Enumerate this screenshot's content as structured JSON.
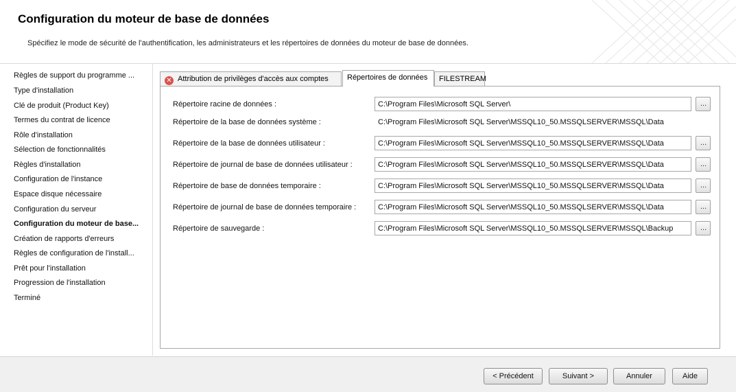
{
  "header": {
    "title": "Configuration du moteur de base de données",
    "subtitle": "Spécifiez le mode de sécurité de l'authentification, les administrateurs et les répertoires de données du moteur de base de données."
  },
  "sidebar": {
    "items": [
      {
        "label": "Règles de support du programme ..."
      },
      {
        "label": "Type d'installation"
      },
      {
        "label": "Clé de produit (Product Key)"
      },
      {
        "label": "Termes du contrat de licence"
      },
      {
        "label": "Rôle d'installation"
      },
      {
        "label": "Sélection de fonctionnalités"
      },
      {
        "label": "Règles d'installation"
      },
      {
        "label": "Configuration de l'instance"
      },
      {
        "label": "Espace disque nécessaire"
      },
      {
        "label": "Configuration du serveur"
      },
      {
        "label": "Configuration du moteur de base...",
        "active": true
      },
      {
        "label": "Création de rapports d'erreurs"
      },
      {
        "label": "Règles de configuration de l'install..."
      },
      {
        "label": "Prêt pour l'installation"
      },
      {
        "label": "Progression de l'installation"
      },
      {
        "label": "Terminé"
      }
    ]
  },
  "tabs": [
    {
      "label": "Attribution de privilèges d'accès aux comptes",
      "icon": "error-icon"
    },
    {
      "label": "Répertoires de données",
      "active": true
    },
    {
      "label": "FILESTREAM"
    }
  ],
  "directories": {
    "root": {
      "label": "Répertoire racine de données :",
      "value": "C:\\Program Files\\Microsoft SQL Server\\"
    },
    "system_db": {
      "label": "Répertoire de la base de données système :",
      "value": "C:\\Program Files\\Microsoft SQL Server\\MSSQL10_50.MSSQLSERVER\\MSSQL\\Data"
    },
    "user_db": {
      "label": "Répertoire de la base de données utilisateur :",
      "value": "C:\\Program Files\\Microsoft SQL Server\\MSSQL10_50.MSSQLSERVER\\MSSQL\\Data"
    },
    "user_log": {
      "label": "Répertoire de journal de base de données utilisateur :",
      "value": "C:\\Program Files\\Microsoft SQL Server\\MSSQL10_50.MSSQLSERVER\\MSSQL\\Data"
    },
    "temp_db": {
      "label": "Répertoire de base de données temporaire :",
      "value": "C:\\Program Files\\Microsoft SQL Server\\MSSQL10_50.MSSQLSERVER\\MSSQL\\Data"
    },
    "temp_log": {
      "label": "Répertoire de journal de base de données temporaire :",
      "value": "C:\\Program Files\\Microsoft SQL Server\\MSSQL10_50.MSSQLSERVER\\MSSQL\\Data"
    },
    "backup": {
      "label": "Répertoire de sauvegarde :",
      "value": "C:\\Program Files\\Microsoft SQL Server\\MSSQL10_50.MSSQLSERVER\\MSSQL\\Backup"
    },
    "browse_label": "..."
  },
  "footer": {
    "prev_label": "< Précédent",
    "next_label": "Suivant >",
    "cancel_label": "Annuler",
    "help_label": "Aide"
  },
  "colors": {
    "error": "#d9534f",
    "border": "#a8a8a8",
    "footer_bg": "#f0f0f0"
  }
}
